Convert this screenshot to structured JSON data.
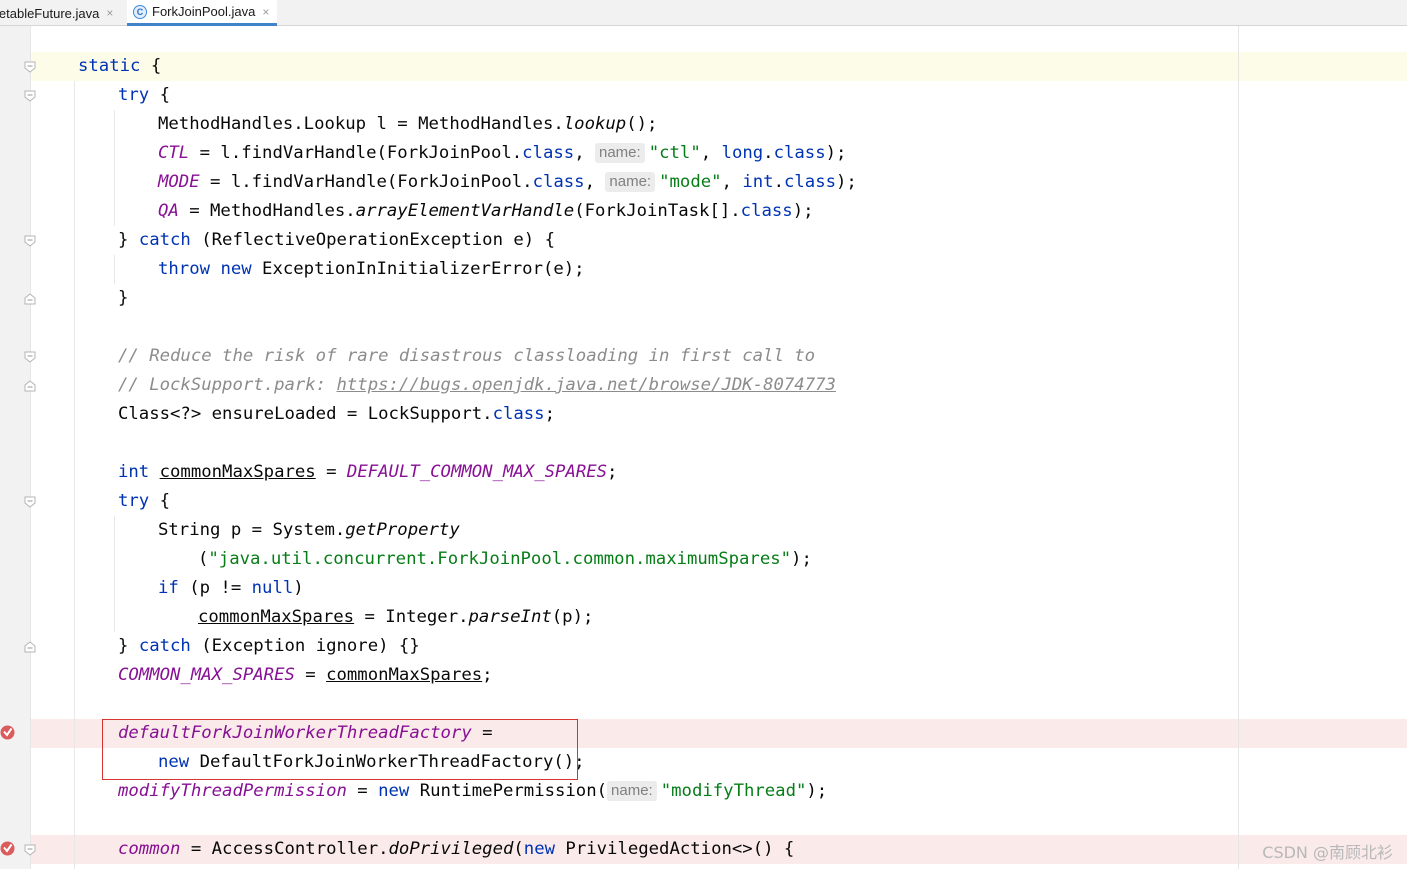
{
  "tabs": [
    {
      "label": "letableFuture.java",
      "close": "×"
    },
    {
      "label": "ForkJoinPool.java",
      "close": "×",
      "icon": "C"
    }
  ],
  "code": {
    "l1_static": "static",
    "brace_open": "{",
    "brace_close": "}",
    "kw_try": "try",
    "kw_catch": "catch",
    "kw_throw": "throw",
    "kw_new": "new",
    "kw_int": "int",
    "kw_long": "long",
    "kw_if": "if",
    "kw_null": "null",
    "kw_class": "class",
    "l3_a": "MethodHandles.Lookup l = MethodHandles.",
    "l3_m": "lookup",
    "l3_b": "();",
    "field_ctl": "CTL",
    "l4_a": " = l.findVarHandle(ForkJoinPool.",
    "hint_name": "name:",
    "str_ctl": "\"ctl\"",
    "field_mode": "MODE",
    "l5_a": " = l.findVarHandle(ForkJoinPool.",
    "str_mode": "\"mode\"",
    "field_qa": "QA",
    "l6_a": " = MethodHandles.",
    "l6_m": "arrayElementVarHandle",
    "l6_b": "(ForkJoinTask[].",
    "l7_b": " (ReflectiveOperationException e) {",
    "l8_b": " ExceptionInInitializerError(e);",
    "comment1": "// Reduce the risk of rare disastrous classloading in first call to",
    "comment2_a": "// LockSupport.park: ",
    "comment2_link": "https://bugs.openjdk.java.net/browse/JDK-8074773",
    "l12_a": "Class<?> ensureLoaded = LockSupport.",
    "var_cms": "commonMaxSpares",
    "field_dcms": "DEFAULT_COMMON_MAX_SPARES",
    "l16_a": "String p = System.",
    "l16_m": "getProperty",
    "str_prop": "\"java.util.concurrent.ForkJoinPool.common.maximumSpares\"",
    "l19_a": " = Integer.",
    "l19_m": "parseInt",
    "l19_b": "(p);",
    "l20_b": " (Exception ignore) {}",
    "field_cms": "COMMON_MAX_SPARES",
    "field_dfjwtf": "defaultForkJoinWorkerThreadFactory",
    "l24_b": " DefaultForkJoinWorkerThreadFactory();",
    "field_mtp": "modifyThreadPermission",
    "l25_b": " RuntimePermission(",
    "str_mt": "\"modifyThread\"",
    "field_common": "common",
    "l27_a": " = AccessController.",
    "l27_m": "doPrivileged",
    "l27_b": " PrivilegedAction<>() {"
  },
  "watermark": "CSDN @南顾北衫",
  "colors": {
    "keyword": "#0033b3",
    "field": "#871094",
    "string": "#067d17",
    "comment": "#8c8c8c",
    "breakpoint": "#db5c5c",
    "highlight_box": "#d93434"
  }
}
